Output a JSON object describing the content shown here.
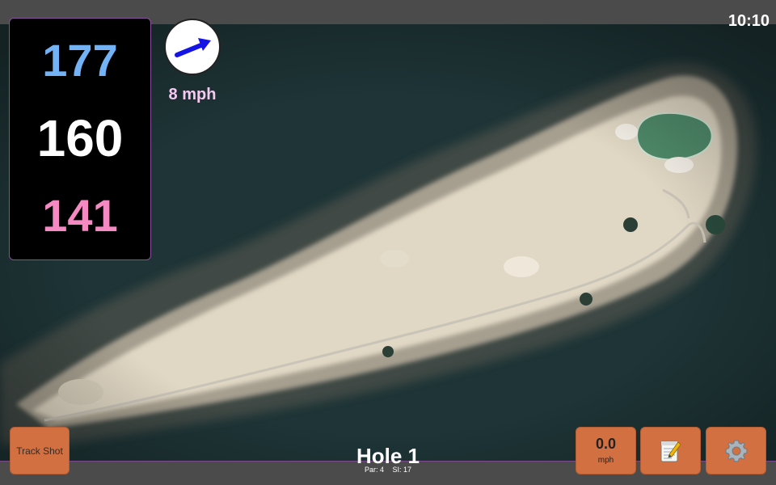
{
  "status": {
    "clock": "10:10"
  },
  "distances": {
    "back": "177",
    "middle": "160",
    "front": "141"
  },
  "wind": {
    "speed": "8 mph",
    "direction_icon": "wind-arrow-icon"
  },
  "hole": {
    "title": "Hole 1",
    "par": "Par: 4",
    "stroke_index": "SI: 17"
  },
  "buttons": {
    "track_shot": "Track Shot",
    "speed_value": "0.0",
    "speed_unit": "mph",
    "notes_icon": "notepad-icon",
    "settings_icon": "gear-icon"
  },
  "colors": {
    "back": "#72b2f5",
    "middle": "#ffffff",
    "front": "#f58ac3",
    "wind_text": "#f7c8f2",
    "arrow": "#1414e6",
    "button": "#d27041",
    "button_border": "#b25d33",
    "accent_border": "#8a4f9c"
  }
}
